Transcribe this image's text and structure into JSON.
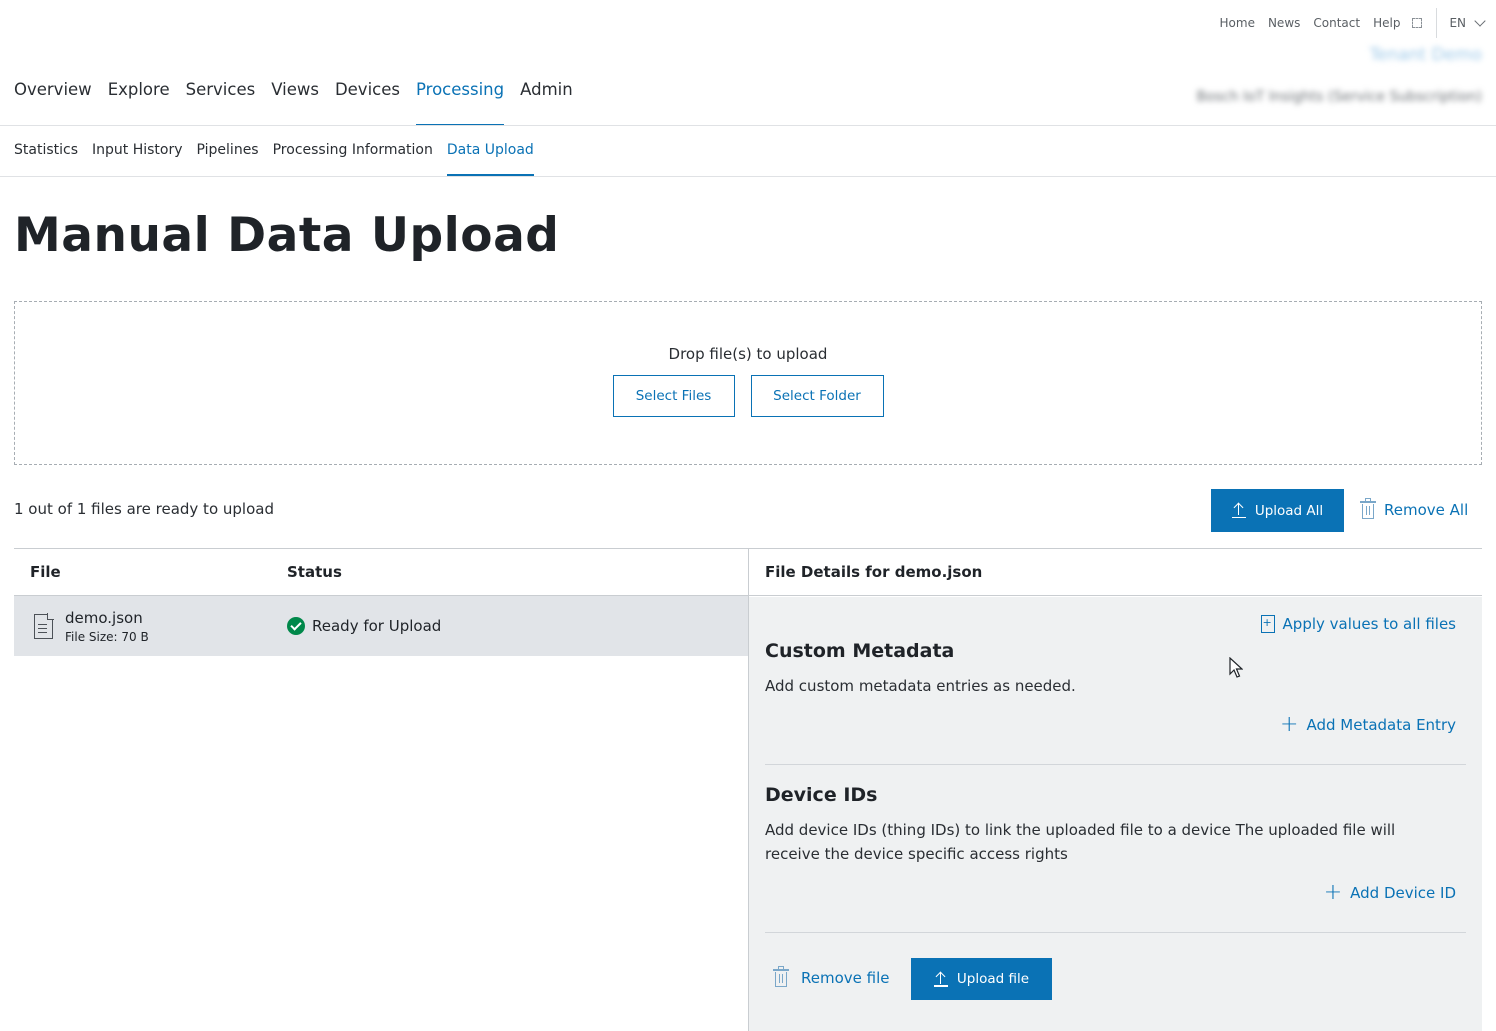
{
  "utility_nav": {
    "links": [
      "Home",
      "News",
      "Contact",
      "Help"
    ],
    "language": "EN"
  },
  "header": {
    "tenant": "Tenant Demo",
    "subscription": "Bosch IoT Insights (Service Subscription)"
  },
  "main_nav": {
    "items": [
      "Overview",
      "Explore",
      "Services",
      "Views",
      "Devices",
      "Processing",
      "Admin"
    ],
    "active": "Processing"
  },
  "sub_nav": {
    "items": [
      "Statistics",
      "Input History",
      "Pipelines",
      "Processing Information",
      "Data Upload"
    ],
    "active": "Data Upload"
  },
  "page": {
    "title": "Manual Data Upload"
  },
  "drop_zone": {
    "text": "Drop file(s) to upload",
    "select_files": "Select Files",
    "select_folder": "Select Folder"
  },
  "summary": {
    "ready_text": "1 out of 1 files are ready to upload",
    "upload_all": "Upload All",
    "remove_all": "Remove All"
  },
  "table": {
    "columns": [
      "File",
      "Status"
    ],
    "rows": [
      {
        "name": "demo.json",
        "size": "File Size: 70 B",
        "status": "Ready for Upload"
      }
    ]
  },
  "details": {
    "title": "File Details for demo.json",
    "apply_all": "Apply values to all files",
    "metadata": {
      "title": "Custom Metadata",
      "description": "Add custom metadata entries as needed.",
      "add": "Add Metadata Entry"
    },
    "devices": {
      "title": "Device IDs",
      "description": "Add device IDs (thing IDs) to link the uploaded file to a device The uploaded file will receive the device specific access rights",
      "add": "Add Device ID"
    },
    "remove_file": "Remove file",
    "upload_file": "Upload file"
  },
  "colors": {
    "accent": "#0a72b5",
    "success": "#00884a",
    "row_selected": "#e1e4e8",
    "panel_bg": "#eff1f2"
  }
}
